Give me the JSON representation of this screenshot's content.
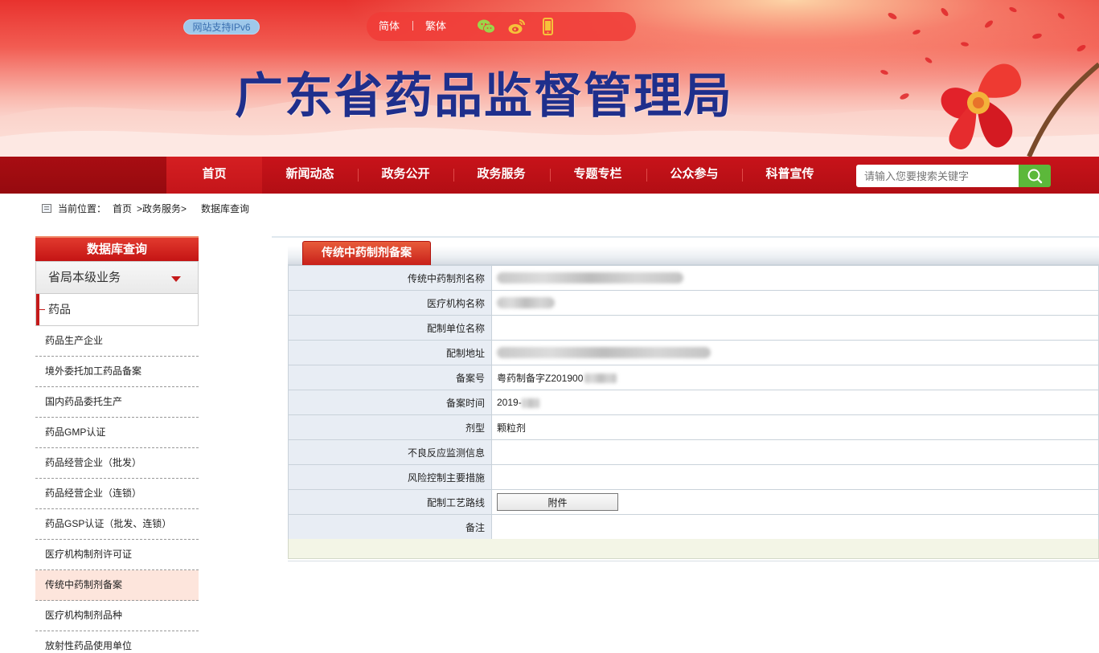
{
  "banner": {
    "ipv6_badge": "网站支持IPv6",
    "lang_simplified": "简体",
    "lang_traditional": "繁体",
    "title": "广东省药品监督管理局"
  },
  "nav": {
    "items": [
      "首页",
      "新闻动态",
      "政务公开",
      "政务服务",
      "专题专栏",
      "公众参与",
      "科普宣传"
    ],
    "search_placeholder": "请输入您要搜索关键字"
  },
  "breadcrumb": {
    "label": "当前位置：",
    "home": "首页",
    "level1": ">政务服务>",
    "level2": "数据库查询"
  },
  "sidebar": {
    "header": "数据库查询",
    "select_value": "省局本级业务",
    "category": "药品",
    "items": [
      "药品生产企业",
      "境外委托加工药品备案",
      "国内药品委托生产",
      "药品GMP认证",
      "药品经营企业（批发）",
      "药品经营企业（连锁）",
      "药品GSP认证（批发、连锁）",
      "医疗机构制剂许可证",
      "传统中药制剂备案",
      "医疗机构制剂品种",
      "放射性药品使用单位"
    ],
    "active_index": 8
  },
  "panel": {
    "tab": "传统中药制剂备案",
    "rows": [
      {
        "label": "传统中药制剂名称",
        "value": ""
      },
      {
        "label": "医疗机构名称",
        "value": ""
      },
      {
        "label": "配制单位名称",
        "value": ""
      },
      {
        "label": "配制地址",
        "value": ""
      },
      {
        "label": "备案号",
        "value": "粤药制备字Z201900"
      },
      {
        "label": "备案时间",
        "value": "2019-"
      },
      {
        "label": "剂型",
        "value": "颗粒剂"
      },
      {
        "label": "不良反应监测信息",
        "value": ""
      },
      {
        "label": "风险控制主要措施",
        "value": ""
      },
      {
        "label": "配制工艺路线",
        "value": ""
      },
      {
        "label": "备注",
        "value": ""
      }
    ],
    "attachment_button": "附件"
  },
  "colors": {
    "brand_red": "#c8131a",
    "title_blue": "#1f2f8c",
    "search_green": "#5cb83a"
  }
}
